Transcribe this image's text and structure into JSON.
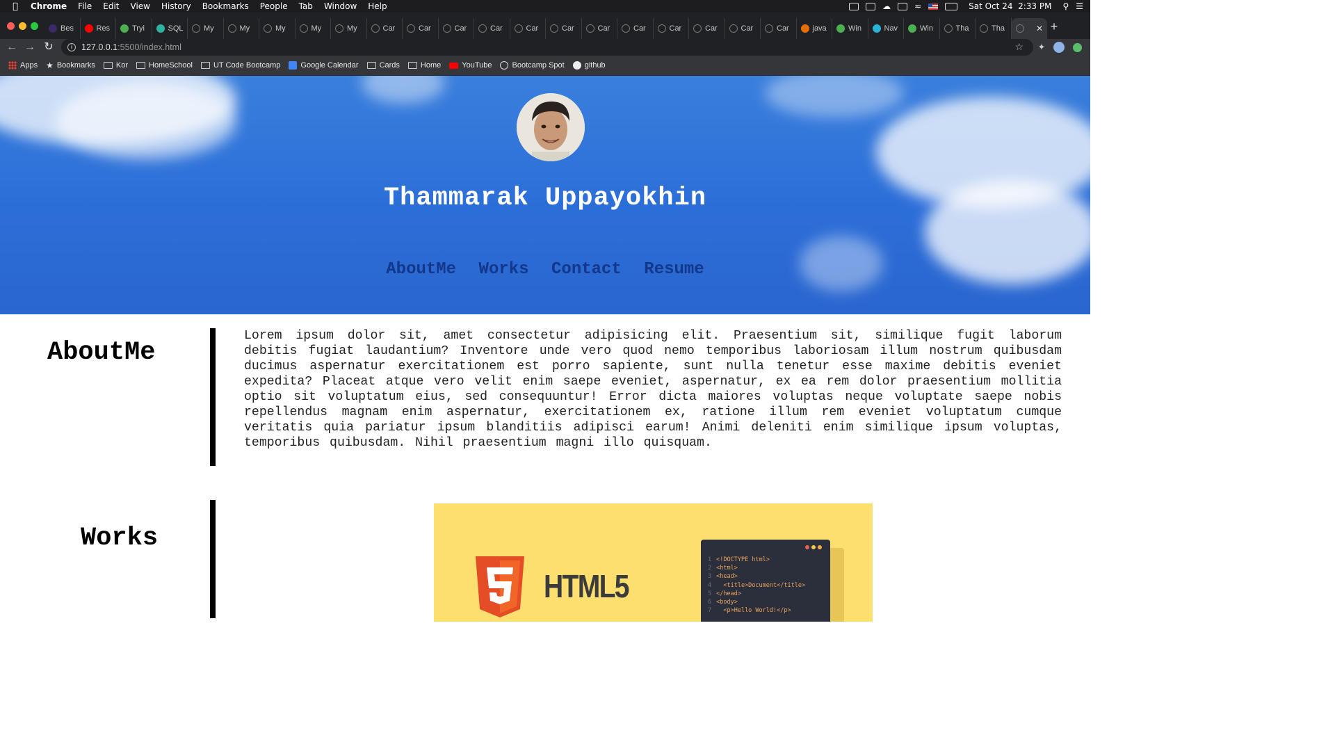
{
  "menubar": {
    "app": "Chrome",
    "items": [
      "File",
      "Edit",
      "View",
      "History",
      "Bookmarks",
      "People",
      "Tab",
      "Window",
      "Help"
    ],
    "datetime": "Sat Oct 24  2:33 PM"
  },
  "tabs": [
    {
      "label": "Bes",
      "icon": "generic-favicon"
    },
    {
      "label": "Res",
      "icon": "youtube-icon"
    },
    {
      "label": "Tryi",
      "icon": "chart-favicon"
    },
    {
      "label": "SQL",
      "icon": "db-favicon"
    },
    {
      "label": "My",
      "icon": "globe-icon"
    },
    {
      "label": "My",
      "icon": "globe-icon"
    },
    {
      "label": "My",
      "icon": "globe-icon"
    },
    {
      "label": "My",
      "icon": "globe-icon"
    },
    {
      "label": "My",
      "icon": "globe-icon"
    },
    {
      "label": "Car",
      "icon": "globe-icon"
    },
    {
      "label": "Car",
      "icon": "globe-icon"
    },
    {
      "label": "Car",
      "icon": "globe-icon"
    },
    {
      "label": "Car",
      "icon": "globe-icon"
    },
    {
      "label": "Car",
      "icon": "globe-icon"
    },
    {
      "label": "Car",
      "icon": "globe-icon"
    },
    {
      "label": "Car",
      "icon": "globe-icon"
    },
    {
      "label": "Car",
      "icon": "globe-icon"
    },
    {
      "label": "Car",
      "icon": "globe-icon"
    },
    {
      "label": "Car",
      "icon": "globe-icon"
    },
    {
      "label": "Car",
      "icon": "globe-icon"
    },
    {
      "label": "Car",
      "icon": "globe-icon"
    },
    {
      "label": "java",
      "icon": "java-icon"
    },
    {
      "label": "Win",
      "icon": "chart-favicon"
    },
    {
      "label": "Nav",
      "icon": "nav-favicon"
    },
    {
      "label": "Win",
      "icon": "chart-favicon"
    },
    {
      "label": "Tha",
      "icon": "globe-icon"
    },
    {
      "label": "Tha",
      "icon": "globe-icon"
    },
    {
      "label": "",
      "icon": "globe-icon",
      "active": true
    }
  ],
  "address_bar": {
    "host": "127.0.0.1",
    "rest": ":5500/index.html"
  },
  "bookmarks": [
    {
      "label": "Apps",
      "icon": "apps-grid-icon"
    },
    {
      "label": "Bookmarks",
      "icon": "star-icon"
    },
    {
      "label": "Kor",
      "icon": "folder-icon"
    },
    {
      "label": "HomeSchool",
      "icon": "folder-icon"
    },
    {
      "label": "UT Code Bootcamp",
      "icon": "folder-icon"
    },
    {
      "label": "Google Calendar",
      "icon": "calendar-icon"
    },
    {
      "label": "Cards",
      "icon": "folder-icon"
    },
    {
      "label": "Home",
      "icon": "folder-icon"
    },
    {
      "label": "YouTube",
      "icon": "youtube-icon"
    },
    {
      "label": "Bootcamp Spot",
      "icon": "bootcamp-icon"
    },
    {
      "label": "github",
      "icon": "github-icon"
    }
  ],
  "hero": {
    "name": "Thammarak Uppayokhin",
    "nav": [
      "AboutMe",
      "Works",
      "Contact",
      "Resume"
    ]
  },
  "about": {
    "title": "AboutMe",
    "text": "Lorem ipsum dolor sit, amet consectetur adipisicing elit. Praesentium sit, similique fugit laborum debitis fugiat laudantium? Inventore unde vero quod nemo temporibus laboriosam illum nostrum quibusdam ducimus aspernatur exercitationem est porro sapiente, sunt nulla tenetur esse maxime debitis eveniet expedita? Placeat atque vero velit enim saepe eveniet, aspernatur, ex ea rem dolor praesentium mollitia optio sit voluptatum eius, sed consequuntur! Error dicta maiores voluptas neque voluptate saepe nobis repellendus magnam enim aspernatur, exercitationem ex, ratione illum rem eveniet voluptatum cumque veritatis quia pariatur ipsum blanditiis adipisci earum! Animi deleniti enim similique ipsum voluptas, temporibus quibusdam. Nihil praesentium magni illo quisquam."
  },
  "works": {
    "title": "Works",
    "card_label": "HTML5",
    "code_lines": [
      {
        "n": "1",
        "code": "<!DOCTYPE html>"
      },
      {
        "n": "2",
        "code": "<html>"
      },
      {
        "n": "3",
        "code": "<head>"
      },
      {
        "n": "4",
        "code": "  <title>Document</title>"
      },
      {
        "n": "5",
        "code": "</head>"
      },
      {
        "n": "6",
        "code": "<body>"
      },
      {
        "n": "7",
        "code": "  <p>Hello World!</p>"
      }
    ]
  },
  "colors": {
    "hero_blue": "#2c6ed8",
    "nav_link": "#13378a",
    "card_yellow": "#fddf6f",
    "html5_orange": "#e44d26"
  }
}
